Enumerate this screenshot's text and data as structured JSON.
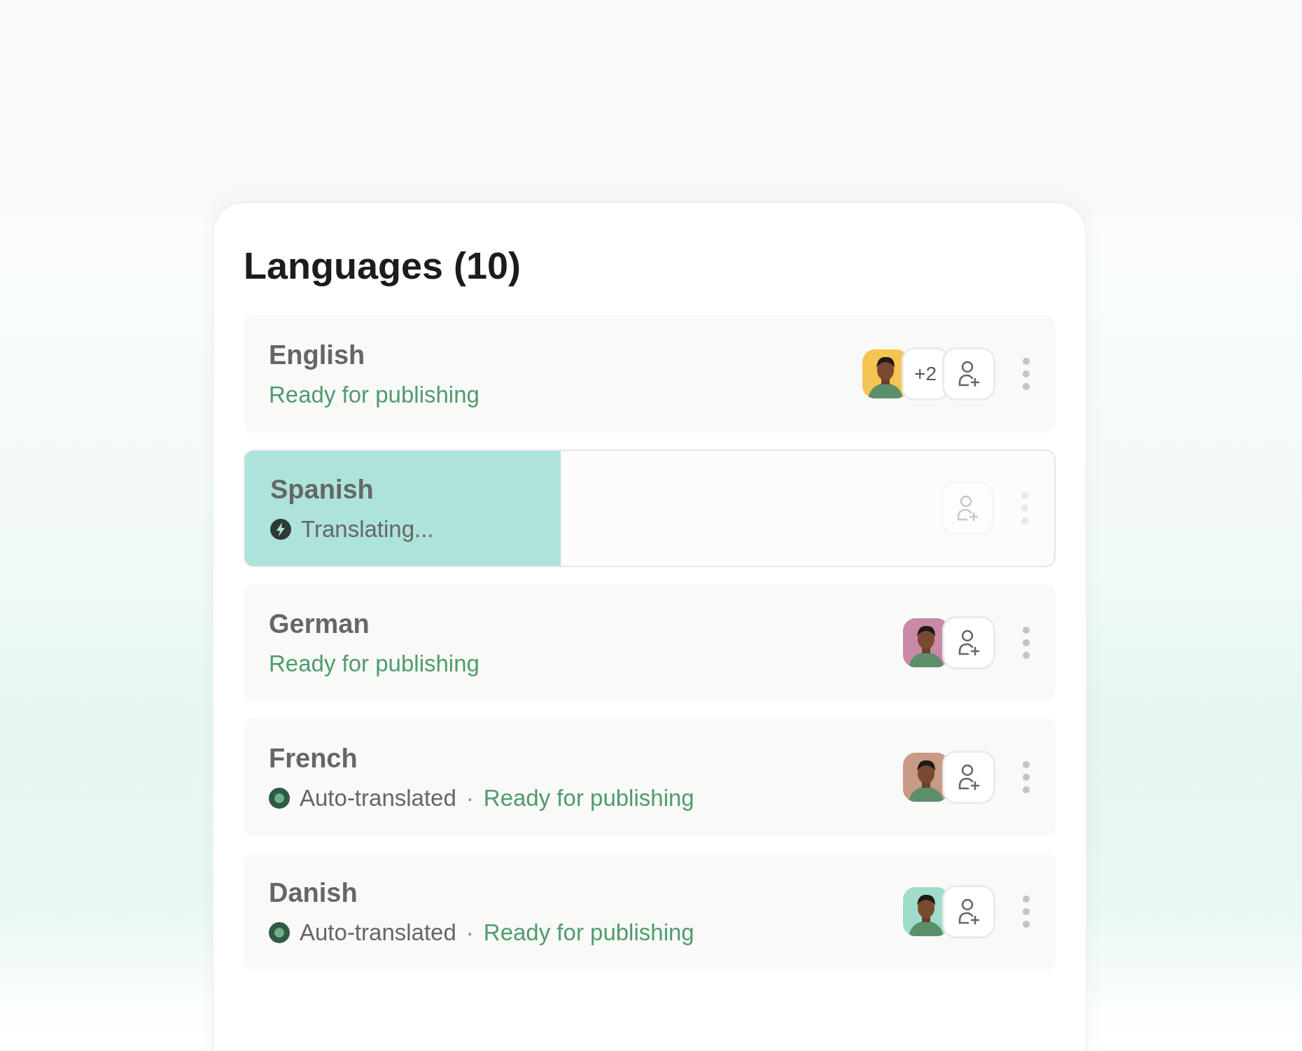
{
  "title": "Languages (10)",
  "languages": [
    {
      "name": "English",
      "actions_disabled": false,
      "status": [
        {
          "kind": "ready",
          "text": "Ready for publishing"
        }
      ],
      "avatars": [
        {
          "kind": "picture",
          "color": "#f5c453"
        }
      ],
      "more": "+2"
    },
    {
      "name": "Spanish",
      "actions_disabled": true,
      "level": 0.39,
      "status": [
        {
          "kind": "bolt"
        },
        {
          "kind": "plain",
          "text": "Translating..."
        }
      ]
    },
    {
      "name": "German",
      "actions_disabled": false,
      "status": [
        {
          "kind": "ready",
          "text": "Ready for publishing"
        }
      ],
      "avatars": [
        {
          "kind": "picture",
          "color": "#c98aa6"
        }
      ]
    },
    {
      "name": "French",
      "actions_disabled": false,
      "status": [
        {
          "kind": "auto"
        },
        {
          "kind": "plain",
          "text": "Auto-translated"
        },
        {
          "kind": "separator",
          "text": "·"
        },
        {
          "kind": "ready",
          "text": "Ready for publishing"
        }
      ],
      "avatars": [
        {
          "kind": "picture",
          "color": "#c99a86"
        }
      ]
    },
    {
      "name": "Danish",
      "actions_disabled": false,
      "status": [
        {
          "kind": "auto"
        },
        {
          "kind": "plain",
          "text": "Auto-translated"
        },
        {
          "kind": "separator",
          "text": "·"
        },
        {
          "kind": "ready",
          "text": "Ready for publishing"
        }
      ],
      "avatars": [
        {
          "kind": "picture",
          "color": "#9fdccb"
        }
      ]
    }
  ]
}
